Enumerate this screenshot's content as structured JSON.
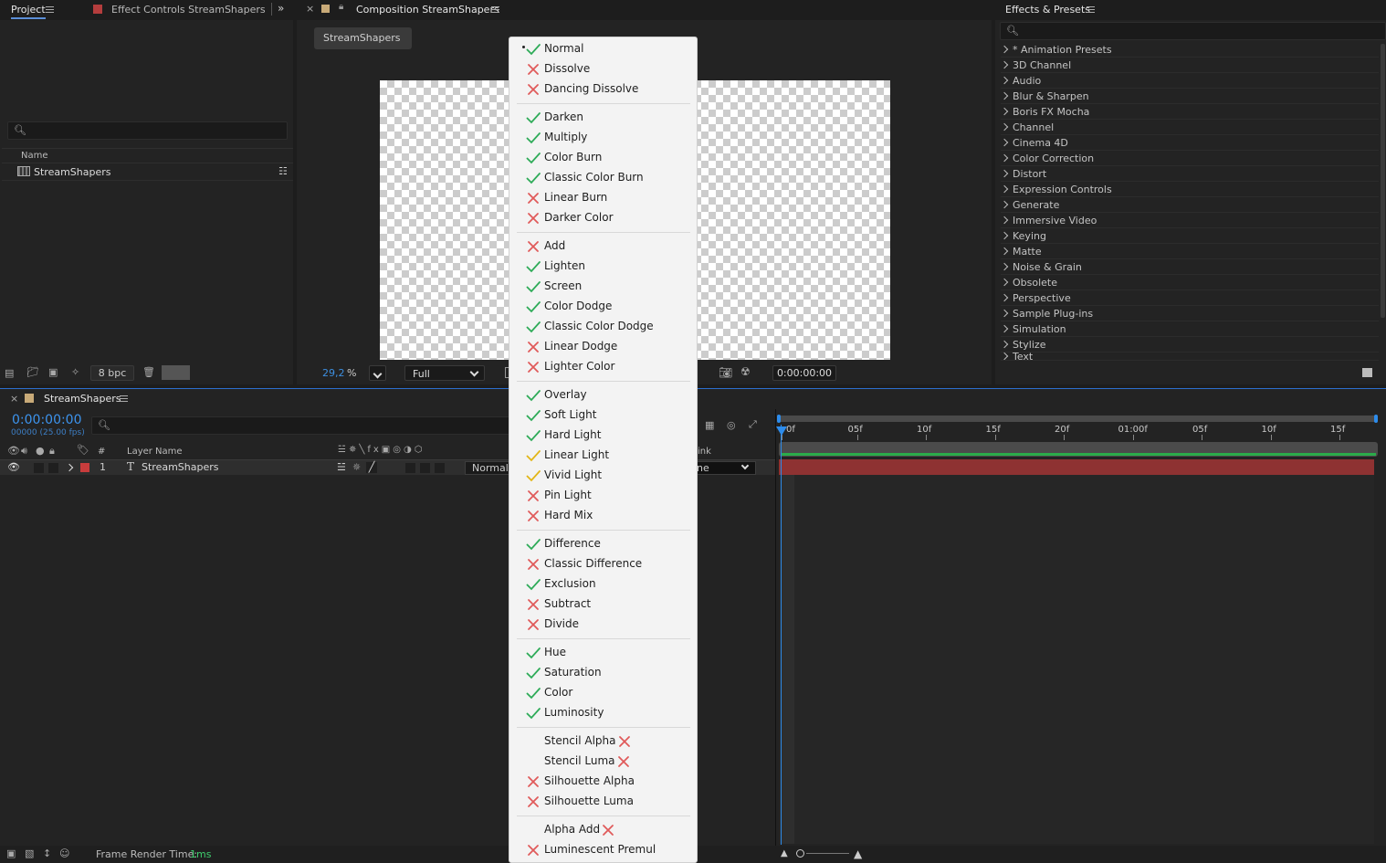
{
  "project_panel": {
    "tab_project": "Project",
    "tab_effect_controls": "Effect Controls StreamShapers",
    "column_name": "Name",
    "item_name": "StreamShapers",
    "bpc": "8 bpc"
  },
  "composition_panel": {
    "tab_title": "Composition StreamShapers",
    "comp_button": "StreamShapers",
    "zoom_value": "29,2",
    "zoom_unit": "%",
    "resolution": "Full",
    "timecode": "0:00:00:00"
  },
  "effects_panel": {
    "title": "Effects & Presets",
    "categories": [
      "* Animation Presets",
      "3D Channel",
      "Audio",
      "Blur & Sharpen",
      "Boris FX Mocha",
      "Channel",
      "Cinema 4D",
      "Color Correction",
      "Distort",
      "Expression Controls",
      "Generate",
      "Immersive Video",
      "Keying",
      "Matte",
      "Noise & Grain",
      "Obsolete",
      "Perspective",
      "Sample Plug-ins",
      "Simulation",
      "Stylize",
      "Text"
    ]
  },
  "timeline": {
    "tab_title": "StreamShapers",
    "timecode": "0:00:00:00",
    "frames_fps": "00000 (25.00 fps)",
    "col_number": "#",
    "col_layer_name": "Layer Name",
    "col_link": "ink",
    "layer_index": "1",
    "layer_name": "StreamShapers",
    "layer_mode": "Normal",
    "parent_value": "ne",
    "ruler_labels": [
      "0f",
      "05f",
      "10f",
      "15f",
      "20f",
      "01:00f",
      "05f",
      "10f",
      "15f"
    ],
    "render_time_label": "Frame Render Time:",
    "render_time_value": "1ms"
  },
  "blend_menu": {
    "groups": [
      [
        {
          "label": "Normal",
          "status": "green",
          "selected": true
        },
        {
          "label": "Dissolve",
          "status": "red"
        },
        {
          "label": "Dancing Dissolve",
          "status": "red"
        }
      ],
      [
        {
          "label": "Darken",
          "status": "green"
        },
        {
          "label": "Multiply",
          "status": "green"
        },
        {
          "label": "Color Burn",
          "status": "green"
        },
        {
          "label": "Classic Color Burn",
          "status": "green"
        },
        {
          "label": "Linear Burn",
          "status": "red"
        },
        {
          "label": "Darker Color",
          "status": "red"
        }
      ],
      [
        {
          "label": "Add",
          "status": "red"
        },
        {
          "label": "Lighten",
          "status": "green"
        },
        {
          "label": "Screen",
          "status": "green"
        },
        {
          "label": "Color Dodge",
          "status": "green"
        },
        {
          "label": "Classic Color Dodge",
          "status": "green"
        },
        {
          "label": "Linear Dodge",
          "status": "red"
        },
        {
          "label": "Lighter Color",
          "status": "red"
        }
      ],
      [
        {
          "label": "Overlay",
          "status": "green"
        },
        {
          "label": "Soft Light",
          "status": "green"
        },
        {
          "label": "Hard Light",
          "status": "green"
        },
        {
          "label": "Linear Light",
          "status": "yellow"
        },
        {
          "label": "Vivid Light",
          "status": "yellow"
        },
        {
          "label": "Pin Light",
          "status": "red"
        },
        {
          "label": "Hard Mix",
          "status": "red"
        }
      ],
      [
        {
          "label": "Difference",
          "status": "green"
        },
        {
          "label": "Classic Difference",
          "status": "red"
        },
        {
          "label": "Exclusion",
          "status": "green"
        },
        {
          "label": "Subtract",
          "status": "red"
        },
        {
          "label": "Divide",
          "status": "red"
        }
      ],
      [
        {
          "label": "Hue",
          "status": "green"
        },
        {
          "label": "Saturation",
          "status": "green"
        },
        {
          "label": "Color",
          "status": "green"
        },
        {
          "label": "Luminosity",
          "status": "green"
        }
      ],
      [
        {
          "label": "Stencil Alpha",
          "status": "red",
          "trailing": true
        },
        {
          "label": "Stencil Luma",
          "status": "red",
          "trailing": true
        },
        {
          "label": "Silhouette Alpha",
          "status": "red"
        },
        {
          "label": "Silhouette Luma",
          "status": "red"
        }
      ],
      [
        {
          "label": "Alpha Add",
          "status": "red",
          "trailing": true
        },
        {
          "label": "Luminescent Premul",
          "status": "red"
        }
      ]
    ]
  },
  "colors": {
    "green": "#2eab58",
    "red": "#e05a5a",
    "yellow": "#e2b617",
    "accent_blue": "#2d8ceb",
    "label_red": "#b43d3d"
  }
}
